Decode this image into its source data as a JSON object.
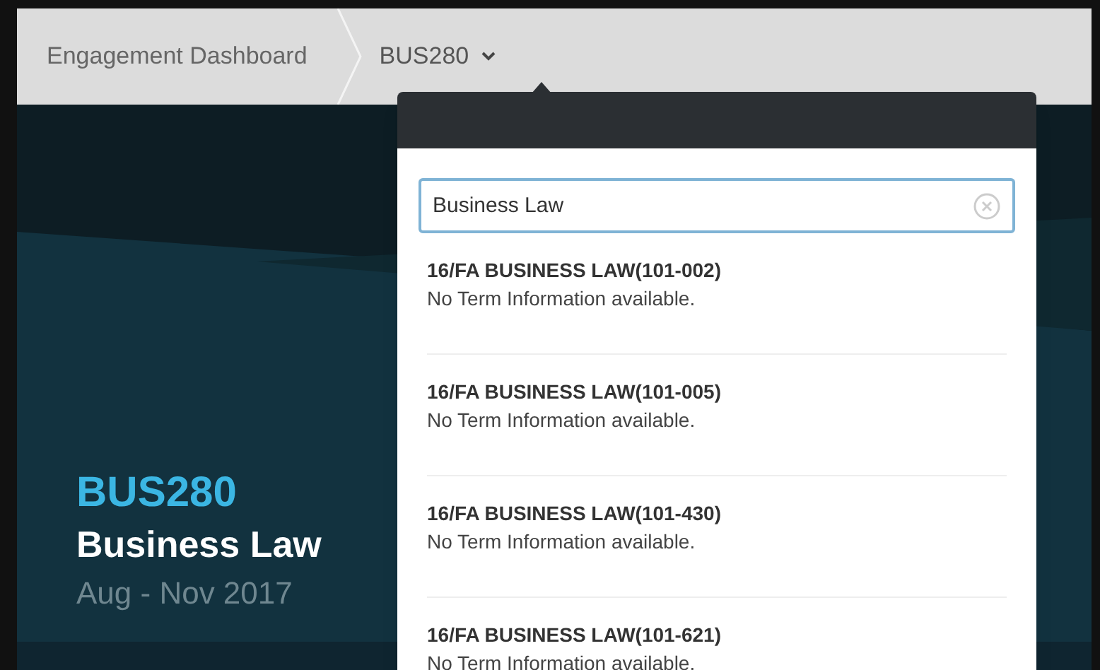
{
  "breadcrumb": [
    {
      "label": "Engagement Dashboard",
      "kind": "link"
    },
    {
      "label": "BUS280",
      "kind": "dropdown"
    }
  ],
  "course": {
    "code": "BUS280",
    "title": "Business Law",
    "dates": "Aug - Nov 2017"
  },
  "dropdown": {
    "search": {
      "value": "Business Law"
    },
    "results": [
      {
        "title": "16/FA BUSINESS LAW(101-002)",
        "subtitle": "No Term Information available."
      },
      {
        "title": "16/FA BUSINESS LAW(101-005)",
        "subtitle": "No Term Information available."
      },
      {
        "title": "16/FA BUSINESS LAW(101-430)",
        "subtitle": "No Term Information available."
      },
      {
        "title": "16/FA BUSINESS LAW(101-621)",
        "subtitle": "No Term Information available."
      }
    ]
  }
}
